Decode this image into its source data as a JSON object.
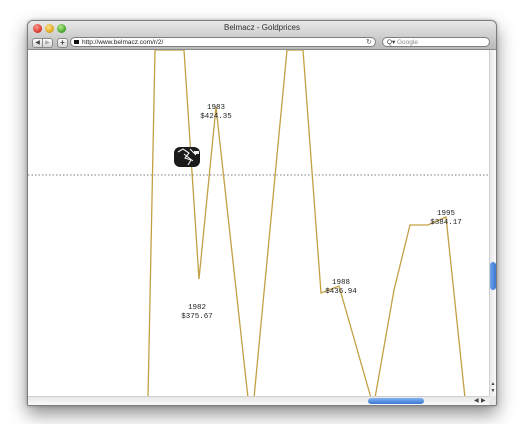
{
  "window": {
    "title": "Belmacz - Goldprices"
  },
  "toolbar": {
    "back_symbol": "◀",
    "forward_symbol": "▶",
    "add_symbol": "+",
    "url": "http://www.belmacz.com/r/2/",
    "reload_symbol": "↻",
    "search_symbol": "Q▾",
    "search_placeholder": "Google"
  },
  "scrollbars": {
    "up_symbol": "▲",
    "down_symbol": "▼",
    "left_symbol": "◀",
    "right_symbol": "▶"
  },
  "labels": {
    "l1983_year": "1983",
    "l1983_price": "$424.35",
    "l1982_year": "1982",
    "l1982_price": "$375.67",
    "l1988_year": "1988",
    "l1988_price": "$436.94",
    "l1995_year": "1995",
    "l1995_price": "$384.17"
  },
  "colors": {
    "line": "#c2a043",
    "accent_blue": "#3a78d6"
  }
}
